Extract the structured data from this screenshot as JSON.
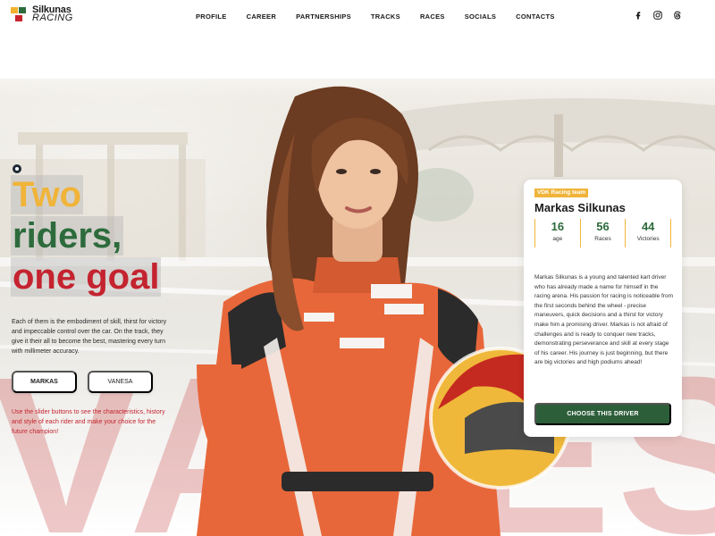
{
  "brand": {
    "line1": "Silkunas",
    "line2": "RACING",
    "colors": {
      "yellow": "#f2b130",
      "green": "#2d6b3c",
      "red": "#c9232d"
    }
  },
  "nav": {
    "items": [
      {
        "label": "PROFILE"
      },
      {
        "label": "CAREER"
      },
      {
        "label": "PARTNERSHIPS"
      },
      {
        "label": "TRACKS"
      },
      {
        "label": "RACES"
      },
      {
        "label": "SOCIALS"
      },
      {
        "label": "CONTACTS"
      }
    ]
  },
  "socials": [
    "facebook-icon",
    "instagram-icon",
    "threads-icon"
  ],
  "hero": {
    "headline": {
      "line1": "Two",
      "line2": "riders,",
      "line3": "one goal"
    },
    "description": "Each of them is the embodiment of skill, thirst for victory and impeccable control over the car. On the track, they give it their all to become the best, mastering every turn with millimeter accuracy.",
    "buttons": {
      "first": "MARKAS",
      "second": "VANESA"
    },
    "slider_hint": "Use the slider buttons to see the characteristics, history and style of each rider and make your choice for the future champion!",
    "background_letters": "VANESA"
  },
  "card": {
    "team": "VDK Racing team",
    "name": "Markas Silkunas",
    "stats": [
      {
        "value": "16",
        "label": "age"
      },
      {
        "value": "56",
        "label": "Races"
      },
      {
        "value": "44",
        "label": "Victories"
      }
    ],
    "description": "Markas Silkunas is a young and talented kart driver who has already made a name for himself in the racing arena. His passion for racing is noticeable from the first seconds behind the wheel - precise maneuvers, quick decisions and a thirst for victory make him a promising driver. Markas is not afraid of challenges and is ready to conquer new tracks, demonstrating perseverance and skill at every stage of his career. His journey is just beginning, but there are big victories and high podiums ahead!",
    "cta": "CHOOSE THIS DRIVER"
  },
  "accent_colors": {
    "yellow": "#f0b43a",
    "green": "#2d6b3c",
    "red": "#c4232f",
    "button_green": "#2d5e3a"
  }
}
